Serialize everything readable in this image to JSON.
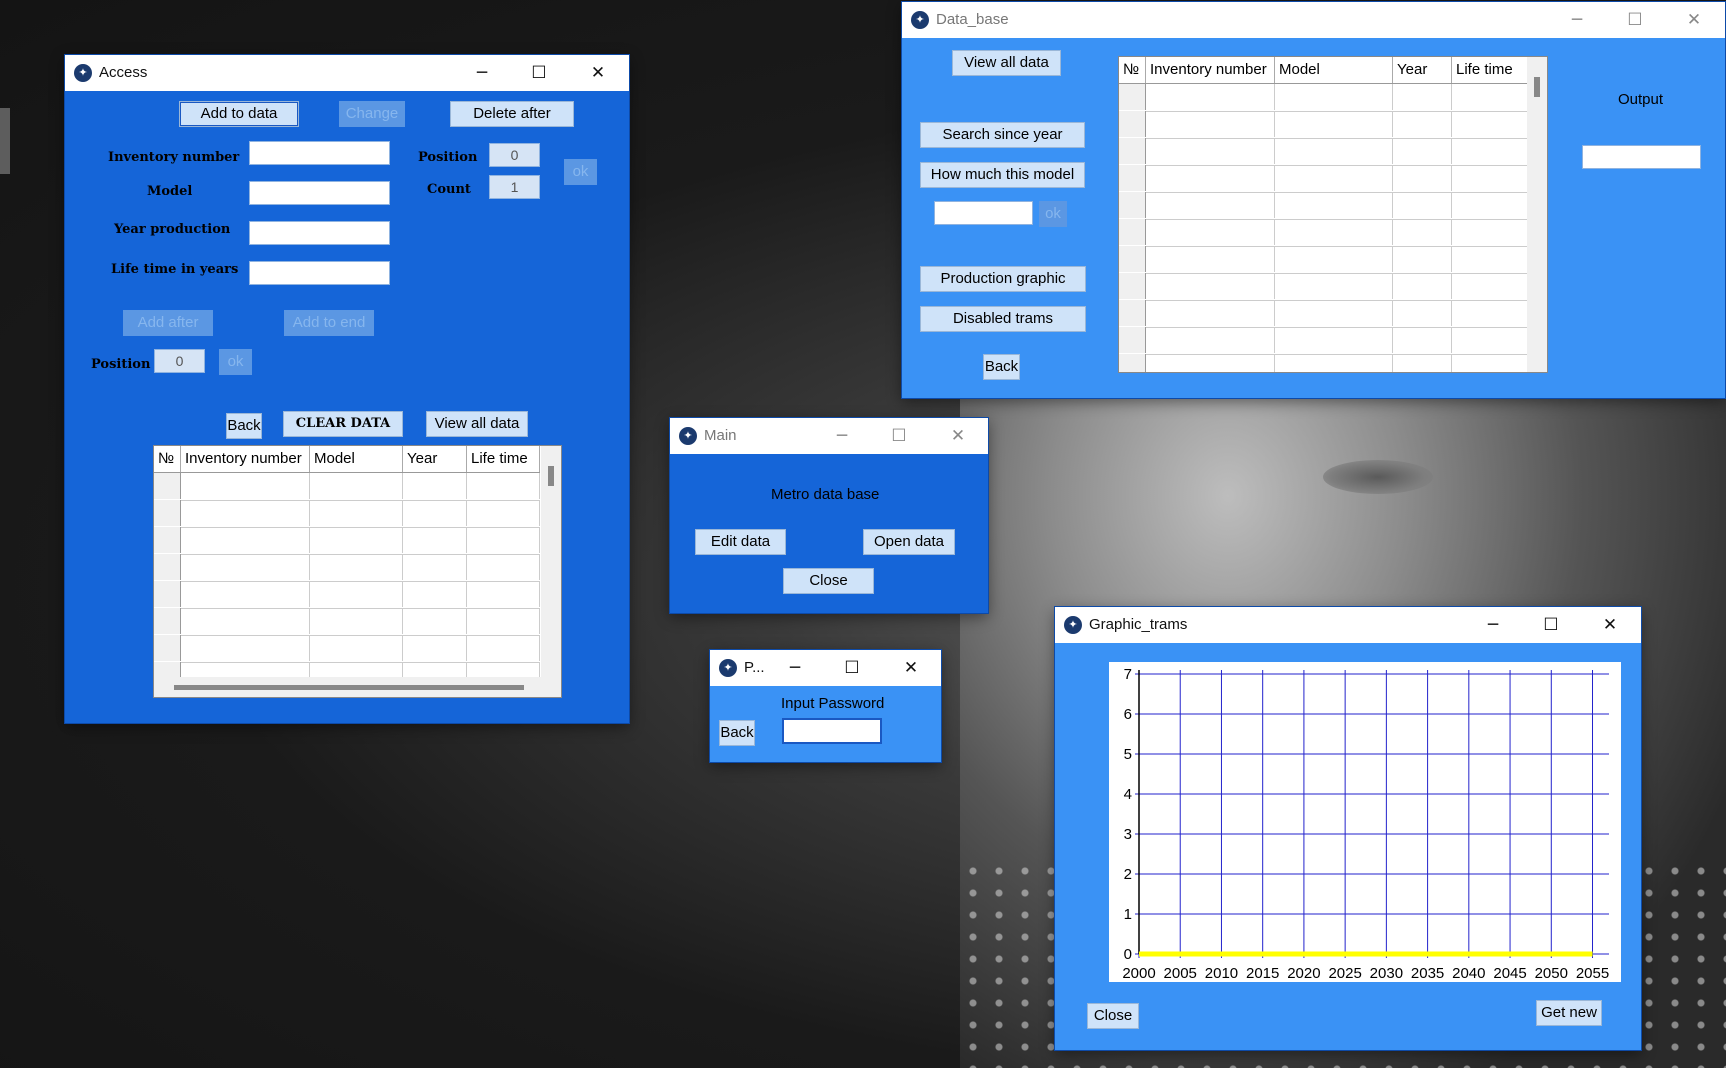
{
  "access": {
    "title": "Access",
    "add_to_data": "Add to data",
    "change": "Change",
    "delete_after": "Delete after",
    "inventory_label": "Inventory number",
    "model_label": "Model",
    "year_label": "Year production",
    "life_label": "Life time in years",
    "position_label": "Position",
    "position_value": "0",
    "count_label": "Count",
    "count_value": "1",
    "ok": "ok",
    "add_after": "Add after",
    "add_to_end": "Add to end",
    "position2_label": "Position",
    "position2_value": "0",
    "ok2": "ok",
    "back": "Back",
    "clear_data": "CLEAR DATA",
    "view_all": "View all data",
    "columns": [
      "№",
      "Inventory number",
      "Model",
      "Year",
      "Life time"
    ]
  },
  "database": {
    "title": "Data_base",
    "view_all": "View all data",
    "search_since_year": "Search since year",
    "how_much_model": "How much this model",
    "ok": "ok",
    "production_graphic": "Production graphic",
    "disabled_trams": "Disabled trams",
    "back": "Back",
    "output_label": "Output",
    "columns": [
      "№",
      "Inventory number",
      "Model",
      "Year",
      "Life time"
    ]
  },
  "main": {
    "title": "Main",
    "heading": "Metro data base",
    "edit_data": "Edit data",
    "open_data": "Open data",
    "close": "Close"
  },
  "password": {
    "title": "P...",
    "prompt": "Input Password",
    "back": "Back"
  },
  "graphic": {
    "title": "Graphic_trams",
    "close": "Close",
    "get_new": "Get new"
  },
  "colors": {
    "grid_line": "#2222cc",
    "series": "#ffff00",
    "window_dark": "#1565d8",
    "window_light": "#3a92f5"
  },
  "chart_data": {
    "type": "line",
    "x_ticks": [
      "2000",
      "2005",
      "2010",
      "2015",
      "2020",
      "2025",
      "2030",
      "2035",
      "2040",
      "2045",
      "2050",
      "2055"
    ],
    "y_ticks": [
      "0",
      "1",
      "2",
      "3",
      "4",
      "5",
      "6",
      "7"
    ],
    "xlim": [
      2000,
      2057
    ],
    "ylim": [
      0,
      7.1
    ],
    "grid": true,
    "series": [
      {
        "x": [
          2000,
          2055
        ],
        "y": [
          0,
          0
        ]
      }
    ]
  }
}
